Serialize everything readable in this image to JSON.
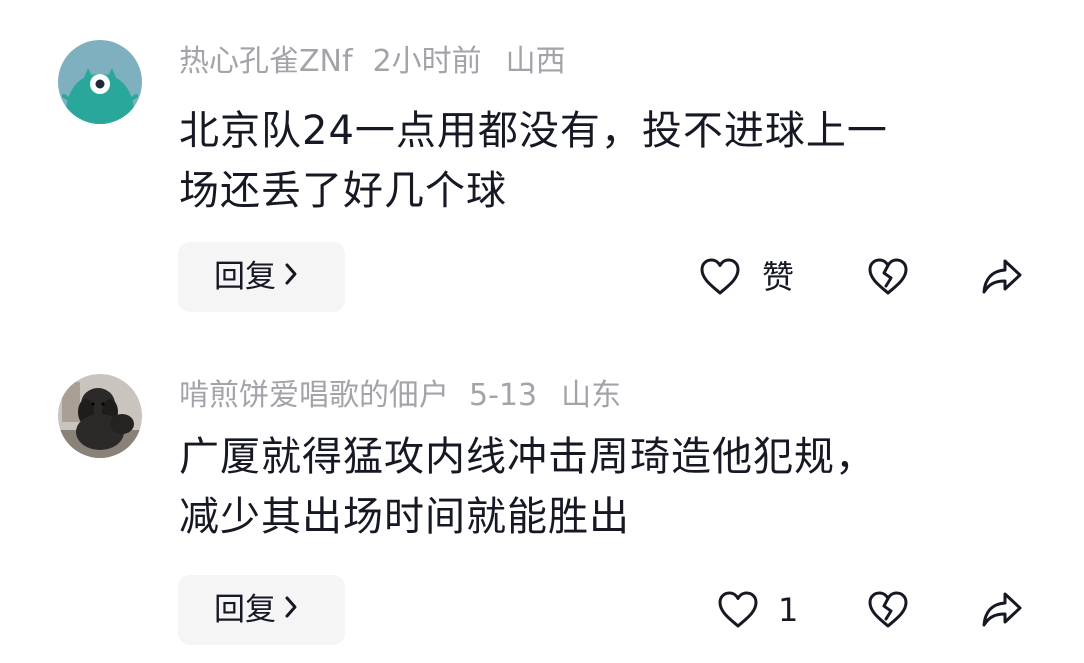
{
  "comments": [
    {
      "username": "热心孔雀ZNf",
      "time": "2小时前",
      "location": "山西",
      "text_lines": [
        "北京队24一点用都没有，投不进球上一",
        "场还丢了好几个球"
      ],
      "reply_label": "回复",
      "like_label": "赞",
      "avatar_color": "#2aa79b"
    },
    {
      "username": "啃煎饼爱唱歌的佃户",
      "time": "5-13",
      "location": "山东",
      "text_lines": [
        "广厦就得猛攻内线冲击周琦造他犯规，",
        "减少其出场时间就能胜出"
      ],
      "reply_label": "回复",
      "like_label": "1",
      "avatar_color": "#2b2a28"
    }
  ],
  "icons": {
    "like": "heart-outline-icon",
    "dislike": "broken-heart-icon",
    "share": "share-arrow-icon",
    "reply_chevron": "chevron-right-icon"
  },
  "colors": {
    "meta_text": "#a3a4a9",
    "body_text": "#161823",
    "reply_bg": "#f5f5f5",
    "icon_stroke": "#161823"
  }
}
